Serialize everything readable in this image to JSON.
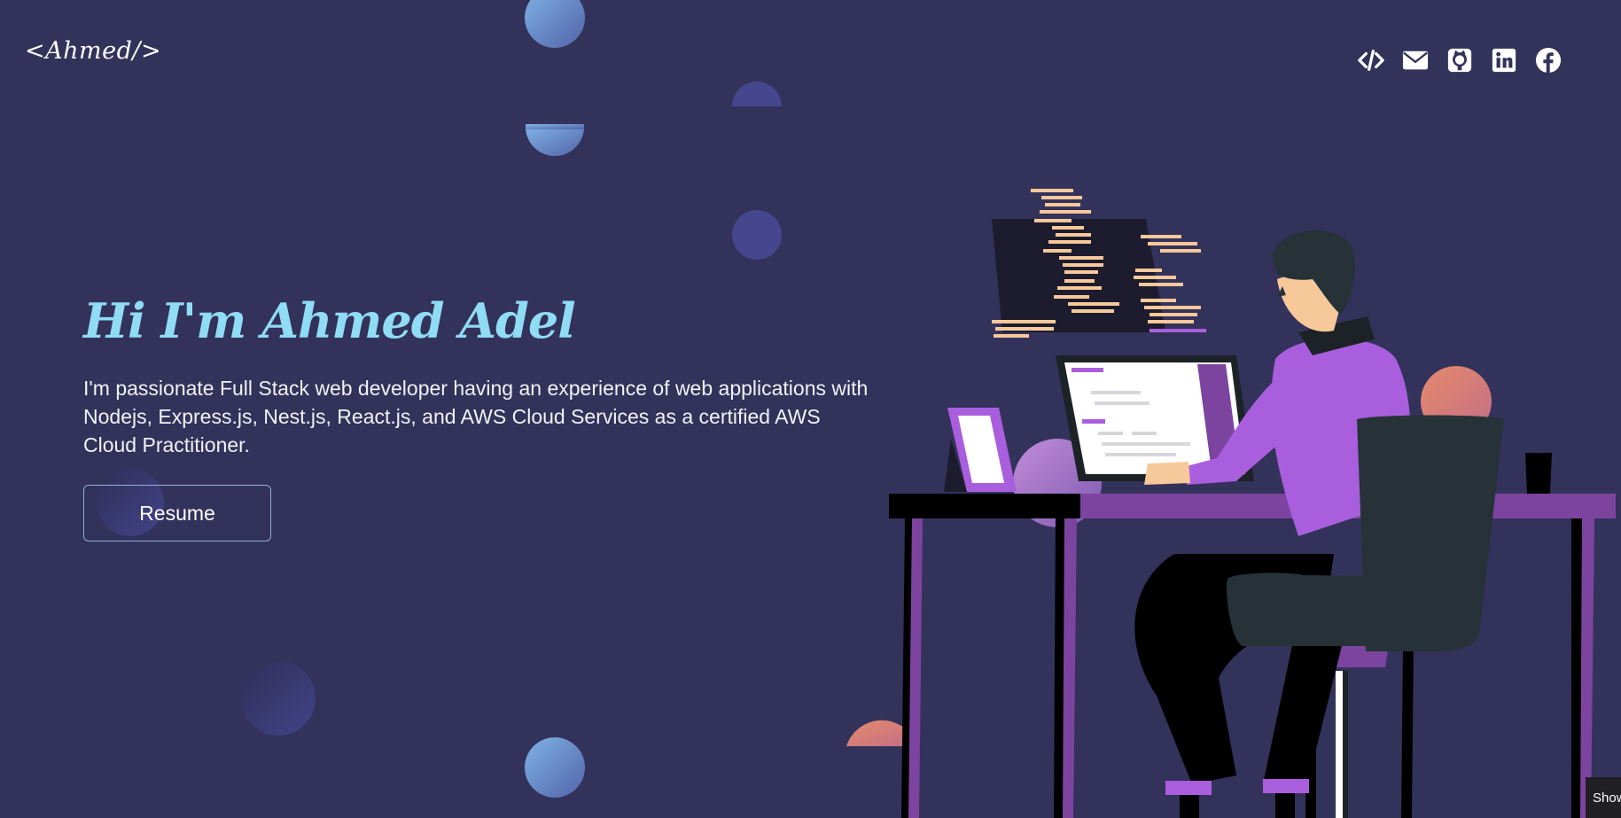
{
  "header": {
    "logo_text": "<Ahmed/>",
    "social_icons": [
      "code-icon",
      "mail-icon",
      "github-icon",
      "linkedin-icon",
      "facebook-icon"
    ]
  },
  "hero": {
    "title": "Hi I'm Ahmed Adel",
    "description": "I'm passionate Full Stack web developer having an experience of web applications with Nodejs, Express.js, Nest.js, React.js, and AWS Cloud Services as a certified AWS Cloud Practitioner.",
    "resume_label": "Resume"
  },
  "corner_tab": {
    "label": "Show"
  },
  "colors": {
    "background": "#33325b",
    "title": "#8fdcf4",
    "accent_purple": "#a95fdd",
    "desk_purple": "#7c449f"
  }
}
